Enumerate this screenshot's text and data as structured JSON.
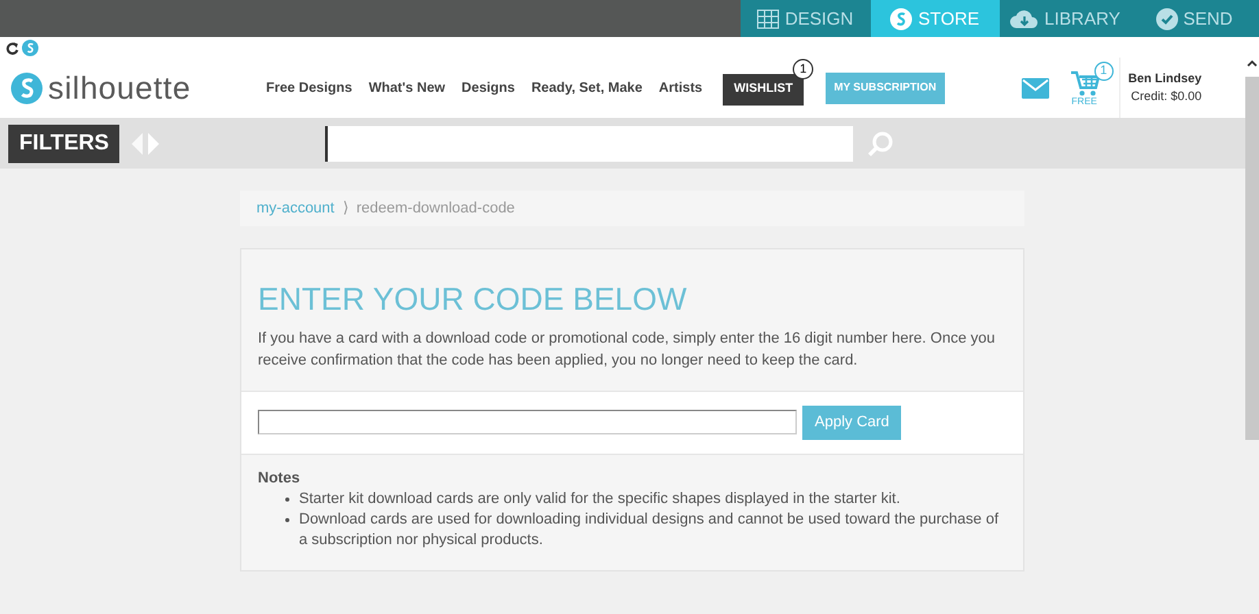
{
  "app_tabs": [
    {
      "label": "DESIGN",
      "kind": "grid",
      "selected": false
    },
    {
      "label": "STORE",
      "kind": "logo",
      "selected": true
    },
    {
      "label": "LIBRARY",
      "kind": "cloud",
      "selected": false
    },
    {
      "label": "SEND",
      "kind": "check",
      "selected": false
    }
  ],
  "logo": "silhouette",
  "nav": [
    "Free Designs",
    "What's New",
    "Designs",
    "Ready, Set, Make",
    "Artists"
  ],
  "wishlist": {
    "label": "WISHLIST",
    "count": "1"
  },
  "subscription": "MY SUBSCRIPTION",
  "cart": {
    "count": "1",
    "caption": "FREE"
  },
  "user": {
    "name": "Ben Lindsey",
    "credit": "Credit: $0.00"
  },
  "filters": "FILTERS",
  "breadcrumb": [
    "my-account",
    "⟩",
    "redeem-download-code"
  ],
  "card": {
    "heading": "ENTER YOUR CODE BELOW",
    "intro": "If you have a card with a download code or promotional code, simply enter the 16 digit number here. Once you receive confirmation that the code has been applied, you no longer need to keep the card.",
    "button": "Apply Card",
    "notes_title": "Notes",
    "notes": [
      "Starter kit download cards are only valid for the specific shapes displayed in the starter kit.",
      "Download cards are used for downloading individual designs and cannot be used toward the purchase of a subscription nor physical products."
    ]
  }
}
